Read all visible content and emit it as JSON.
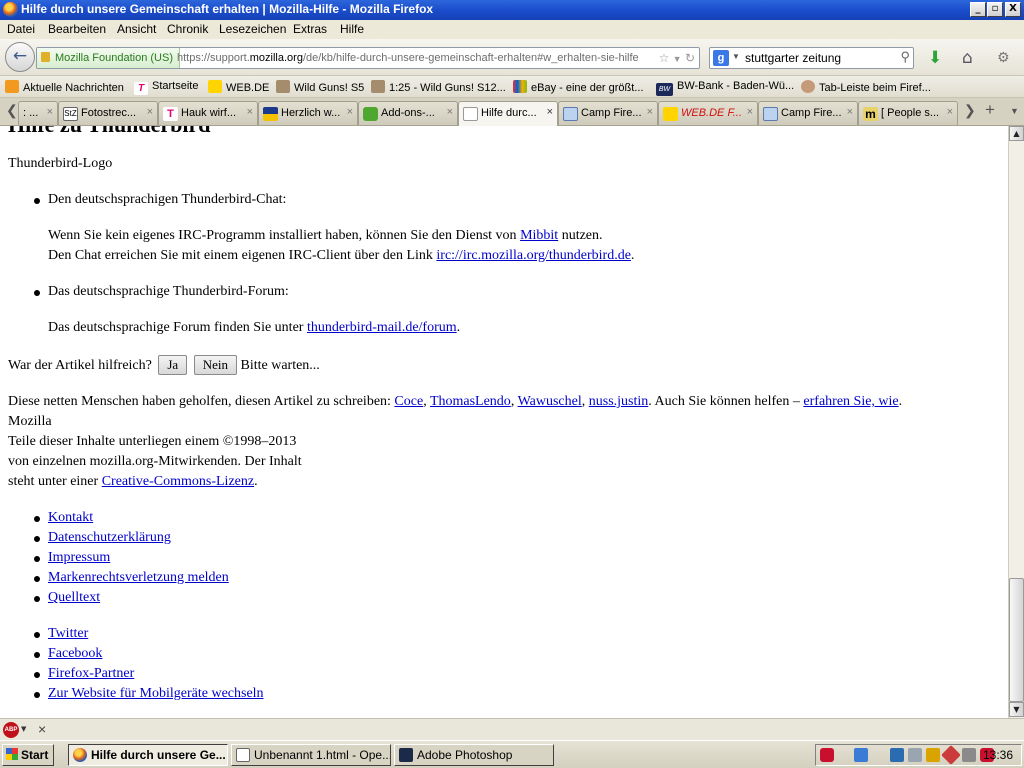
{
  "window": {
    "title": "Hilfe durch unsere Gemeinschaft erhalten | Mozilla-Hilfe - Mozilla Firefox",
    "buttons": {
      "minimize": "_",
      "maximize": "▫",
      "close": "X"
    }
  },
  "menu": [
    "Datei",
    "Bearbeiten",
    "Ansicht",
    "Chronik",
    "Lesezeichen",
    "Extras",
    "Hilfe"
  ],
  "nav": {
    "identity": "Mozilla Foundation (US)",
    "url_prefix": "https://support.",
    "url_domain": "mozilla.org",
    "url_rest": "/de/kb/hilfe-durch-unsere-gemeinschaft-erhalten#w_erhalten-sie-hilfe",
    "search_value": "stuttgarter zeitung"
  },
  "bookmarks": [
    "Aktuelle Nachrichten",
    "Startseite",
    "WEB.DE",
    "Wild Guns! S5",
    "1:25 - Wild Guns! S12...",
    "eBay - eine der größt...",
    "BW-Bank - Baden-Wü...",
    "Tab-Leiste beim Firef..."
  ],
  "tabs": [
    ": ...",
    "Fotostrec...",
    "Hauk wirf...",
    "Herzlich w...",
    "Add-ons-...",
    "Hilfe durc...",
    "Camp Fire...",
    "WEB.DE F...",
    "Camp Fire...",
    "[ People s..."
  ],
  "content": {
    "heading": "Hilfe zu Thunderbird",
    "logo_text": "Thunderbird-Logo",
    "chat_title": "Den deutschsprachigen Thunderbird-Chat:",
    "chat_line1_a": "Wenn Sie kein eigenes IRC-Programm installiert haben, können Sie den Dienst von ",
    "chat_line1_link": "Mibbit",
    "chat_line1_b": " nutzen.",
    "chat_line2_a": "Den Chat erreichen Sie mit einem eigenen IRC-Client über den Link ",
    "chat_line2_link": "irc://irc.mozilla.org/thunderbird.de",
    "chat_line2_b": ".",
    "forum_title": "Das deutschsprachige Thunderbird-Forum:",
    "forum_line_a": "Das deutschsprachige Forum finden Sie unter ",
    "forum_line_link": "thunderbird-mail.de/forum",
    "forum_line_b": ".",
    "helpful_q": "War der Artikel hilfreich?",
    "yes": "Ja",
    "no": "Nein",
    "wait": "Bitte warten...",
    "contrib_a": "Diese netten Menschen haben geholfen, diesen Artikel zu schreiben: ",
    "contributors": [
      "Coce",
      "ThomasLendo",
      "Wawuschel",
      "nuss.justin"
    ],
    "contrib_b": ". Auch Sie können helfen – ",
    "contrib_link": "erfahren Sie, wie",
    "contrib_c": ".",
    "mozilla": "Mozilla",
    "copy1": "Teile dieser Inhalte unterliegen einem ©1998–2013",
    "copy2": "von einzelnen mozilla.org-Mitwirkenden. Der Inhalt",
    "copy3_a": "steht unter einer ",
    "copy3_link": "Creative-Commons-Lizenz",
    "copy3_b": ".",
    "footer_links_1": [
      "Kontakt",
      "Datenschutzerklärung",
      "Impressum",
      "Markenrechtsverletzung melden",
      "Quelltext"
    ],
    "footer_links_2": [
      "Twitter",
      "Facebook",
      "Firefox-Partner",
      "Zur Website für Mobilgeräte wechseln"
    ]
  },
  "addon_bar": {
    "abp": "ABP",
    "close": "×"
  },
  "taskbar": {
    "start": "Start",
    "tasks": [
      "Hilfe durch unsere Ge...",
      "Unbenannt 1.html - Ope...",
      "Adobe Photoshop"
    ],
    "clock": "13:36"
  }
}
